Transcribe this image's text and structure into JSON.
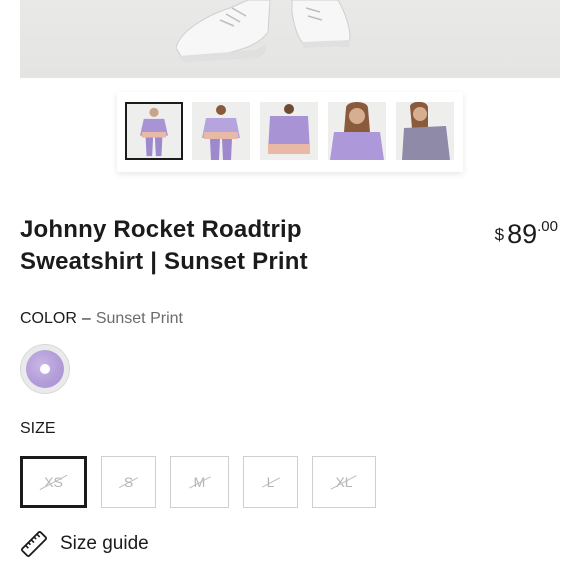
{
  "product": {
    "title": "Johnny Rocket Roadtrip Sweatshirt | Sunset Print",
    "price": {
      "currency": "$",
      "whole": "89",
      "cents": ".00"
    }
  },
  "color": {
    "label": "COLOR",
    "separator": "–",
    "selected": "Sunset Print",
    "swatch_color": "#b8a3dc"
  },
  "size": {
    "label": "SIZE",
    "options": [
      {
        "label": "XS",
        "selected": true,
        "available": false
      },
      {
        "label": "S",
        "selected": false,
        "available": false
      },
      {
        "label": "M",
        "selected": false,
        "available": false
      },
      {
        "label": "L",
        "selected": false,
        "available": false
      },
      {
        "label": "XL",
        "selected": false,
        "available": false
      }
    ]
  },
  "size_guide": {
    "label": "Size guide",
    "icon": "ruler-icon"
  },
  "gallery": {
    "thumbnail_count": 5,
    "active_index": 0
  },
  "colors": {
    "text": "#1b1b1b",
    "muted": "#6b6b6b",
    "border": "#cfcfcf",
    "lavender": "#b19bd8",
    "peach": "#e8b9a6"
  }
}
